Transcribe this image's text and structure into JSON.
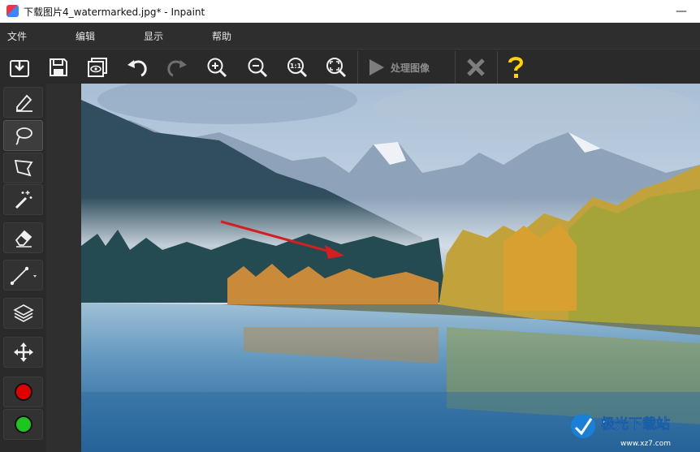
{
  "window": {
    "title": "下载图片4_watermarked.jpg* - Inpaint",
    "minimize_label": "—"
  },
  "menu": {
    "items": [
      "文件",
      "编辑",
      "显示",
      "帮助"
    ]
  },
  "toolbar": {
    "process_label": "处理图像",
    "zoom_actual_label": "1:1"
  },
  "colors": {
    "marker_red": "#e00000",
    "marker_green": "#1ec51e",
    "help_yellow": "#ffd400",
    "annotation_arrow": "#d31f1f"
  },
  "watermark": {
    "brand": "极光下载站",
    "url": "www.xz7.com"
  }
}
